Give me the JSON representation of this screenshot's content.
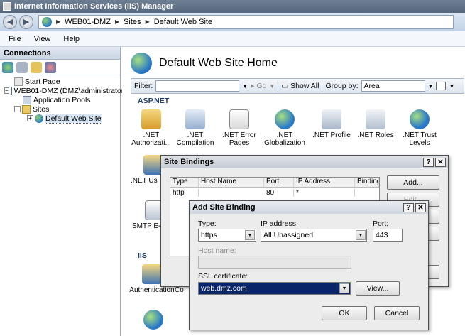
{
  "window": {
    "title": "Internet Information Services (IIS) Manager"
  },
  "address": {
    "crumbs": [
      "WEB01-DMZ",
      "Sites",
      "Default Web Site"
    ]
  },
  "menu": [
    "File",
    "View",
    "Help"
  ],
  "connections": {
    "header": "Connections",
    "tree": [
      {
        "label": "Start Page",
        "icon": "start-page-icon"
      },
      {
        "label": "WEB01-DMZ (DMZ\\administrator)",
        "icon": "server-icon"
      },
      {
        "label": "Application Pools",
        "icon": "app-pool-icon"
      },
      {
        "label": "Sites",
        "icon": "sites-folder-icon"
      },
      {
        "label": "Default Web Site",
        "icon": "website-globe-icon"
      }
    ]
  },
  "main": {
    "title": "Default Web Site Home",
    "filter_label": "Filter:",
    "go_label": "Go",
    "show_all_label": "Show All",
    "group_by_label": "Group by:",
    "group_by_value": "Area",
    "sections": {
      "aspnet": "ASP.NET",
      "iis": "IIS"
    },
    "features": [
      {
        "label": ".NET Authorizati...",
        "icon": "net-authorization-icon"
      },
      {
        "label": ".NET Compilation",
        "icon": "net-compilation-icon"
      },
      {
        "label": ".NET Error Pages",
        "icon": "net-error-pages-icon"
      },
      {
        "label": ".NET Globalization",
        "icon": "net-globalization-icon"
      },
      {
        "label": ".NET Profile",
        "icon": "net-profile-icon"
      },
      {
        "label": ".NET Roles",
        "icon": "net-roles-icon"
      },
      {
        "label": ".NET Trust Levels",
        "icon": "net-trust-levels-icon"
      },
      {
        "label": ".NET Us",
        "icon": "net-users-icon"
      },
      {
        "label": "SMTP E-",
        "icon": "smtp-email-icon"
      },
      {
        "label": "Authentication",
        "icon": "authentication-icon"
      },
      {
        "label": "Co",
        "icon": "compression-icon"
      }
    ]
  },
  "site_bindings": {
    "title": "Site Bindings",
    "columns": [
      "Type",
      "Host Name",
      "Port",
      "IP Address",
      "Binding"
    ],
    "rows": [
      {
        "type": "http",
        "host": "",
        "port": "80",
        "ip": "*",
        "binding": ""
      }
    ],
    "buttons": {
      "add": "Add...",
      "edit": "Edit..."
    }
  },
  "add_binding": {
    "title": "Add Site Binding",
    "type_label": "Type:",
    "type_value": "https",
    "ip_label": "IP address:",
    "ip_value": "All Unassigned",
    "port_label": "Port:",
    "port_value": "443",
    "host_label": "Host name:",
    "host_value": "",
    "ssl_label": "SSL certificate:",
    "ssl_value": "web.dmz.com",
    "view_button": "View...",
    "ok_button": "OK",
    "cancel_button": "Cancel"
  }
}
